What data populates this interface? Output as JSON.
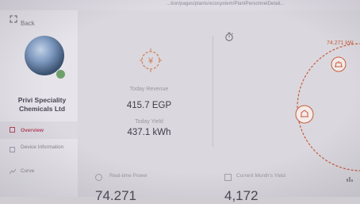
{
  "browser": {
    "url": "...tion/pages/plants/ecosystem/PlantPersonnelDetail..."
  },
  "sidebar": {
    "back_label": "Back",
    "company_name": "Privi Speciality Chemicals Ltd",
    "items": [
      {
        "label": "Overview",
        "active": true
      },
      {
        "label": "Device Information",
        "active": false
      },
      {
        "label": "Curve",
        "active": false
      }
    ]
  },
  "summary": {
    "revenue_label": "Today Revenue",
    "revenue_value": "415.7 EGP",
    "yield_label": "Today Yield",
    "yield_value": "437.1 kWh"
  },
  "flow": {
    "power_label": "74.271 kW"
  },
  "bottom": {
    "left_label": "Real-time Power",
    "left_value": "74.271",
    "right_label": "Current Month's Yield",
    "right_value": "4,172"
  },
  "colors": {
    "accent": "#b7465c",
    "flow": "#c95b3c",
    "status_ok": "#6fa06c"
  }
}
